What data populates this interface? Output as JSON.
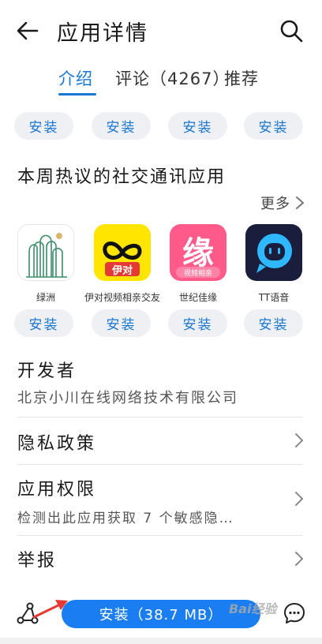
{
  "header": {
    "title": "应用详情",
    "back_icon": "arrow-left-icon",
    "search_icon": "search-icon"
  },
  "tabs": [
    {
      "label": "介绍",
      "active": true
    },
    {
      "label": "评论（4267）",
      "active": false
    },
    {
      "label": "推荐",
      "active": false
    }
  ],
  "top_install_row": [
    "安装",
    "安装",
    "安装",
    "安装"
  ],
  "section": {
    "title": "本周热议的社交通讯应用",
    "more_label": "更多"
  },
  "apps": [
    {
      "name": "绿洲",
      "install_label": "安装"
    },
    {
      "name": "伊对视频相亲交友",
      "icon_text": "伊对",
      "install_label": "安装"
    },
    {
      "name": "世纪佳缘",
      "icon_text": "缘",
      "icon_sub": "视频相亲",
      "install_label": "安装"
    },
    {
      "name": "TT语音",
      "install_label": "安装"
    }
  ],
  "developer": {
    "label": "开发者",
    "name": "北京小川在线网络技术有限公司"
  },
  "privacy": {
    "title": "隐私政策"
  },
  "permissions": {
    "title": "应用权限",
    "subtitle": "检测出此应用获取 7 个敏感隐…"
  },
  "report": {
    "title": "举报"
  },
  "bottom": {
    "install_label": "安装（38.7 MB）",
    "watermark": "Bai经验"
  },
  "colors": {
    "accent": "#1976d2",
    "install_button": "#1a7ef2",
    "pill_bg": "#eef0f3",
    "annotation_arrow": "#e53935"
  }
}
